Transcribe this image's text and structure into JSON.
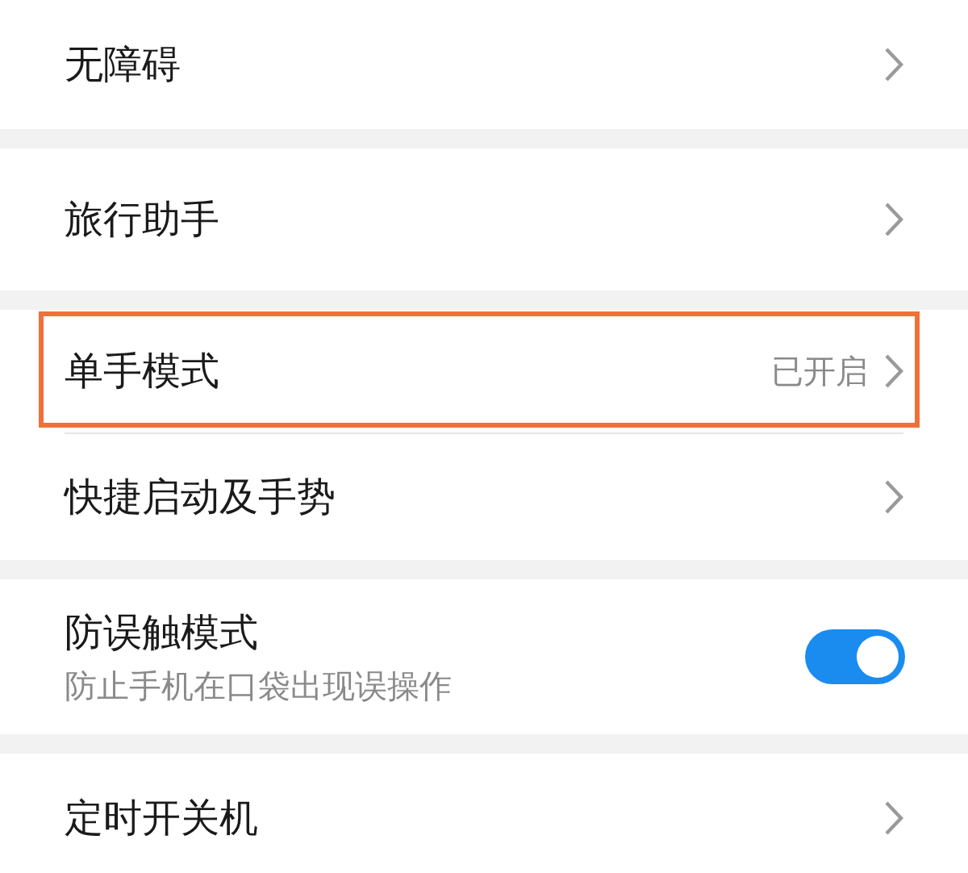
{
  "sections": [
    {
      "items": [
        {
          "kind": "link",
          "title": "无障碍",
          "highlighted": false
        }
      ]
    },
    {
      "items": [
        {
          "kind": "link",
          "title": "旅行助手",
          "highlighted": false
        }
      ]
    },
    {
      "items": [
        {
          "kind": "link",
          "title": "单手模式",
          "value": "已开启",
          "highlighted": true
        },
        {
          "kind": "link",
          "title": "快捷启动及手势",
          "highlighted": false
        }
      ]
    },
    {
      "items": [
        {
          "kind": "switch",
          "title": "防误触模式",
          "subtitle": "防止手机在口袋出现误操作",
          "on": true,
          "highlighted": false
        }
      ]
    },
    {
      "items": [
        {
          "kind": "link",
          "title": "定时开关机",
          "highlighted": false
        }
      ]
    }
  ]
}
